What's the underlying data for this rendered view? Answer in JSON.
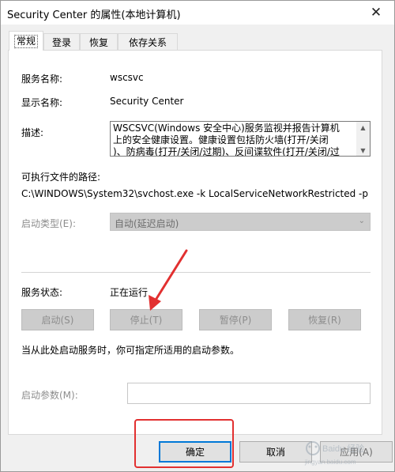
{
  "window": {
    "title": "Security Center 的属性(本地计算机)",
    "close_glyph": "✕"
  },
  "tabs": [
    {
      "label": "常规",
      "active": true
    },
    {
      "label": "登录",
      "active": false
    },
    {
      "label": "恢复",
      "active": false
    },
    {
      "label": "依存关系",
      "active": false
    }
  ],
  "general": {
    "service_name_label": "服务名称:",
    "service_name_value": "wscsvc",
    "display_name_label": "显示名称:",
    "display_name_value": "Security Center",
    "description_label": "描述:",
    "description_value": "WSCSVC(Windows 安全中心)服务监视并报告计算机\n上的安全健康设置。健康设置包括防火墙(打开/关闭\n)、防病毒(打开/关闭/过期)、反间谍软件(打开/关闭/过",
    "exe_path_label": "可执行文件的路径:",
    "exe_path_value": "C:\\WINDOWS\\System32\\svchost.exe -k LocalServiceNetworkRestricted -p",
    "startup_type_label": "启动类型(E):",
    "startup_type_value": "自动(延迟启动)",
    "service_status_label": "服务状态:",
    "service_status_value": "正在运行",
    "start_button": "启动(S)",
    "stop_button": "停止(T)",
    "pause_button": "暂停(P)",
    "resume_button": "恢复(R)",
    "start_params_hint": "当从此处启动服务时，你可指定所适用的启动参数。",
    "start_params_label": "启动参数(M):",
    "start_params_value": ""
  },
  "footer": {
    "ok_button": "确定",
    "cancel_button": "取消",
    "apply_button": "应用(A)"
  },
  "annotation": {
    "color": "#e23030"
  },
  "watermark": {
    "text": "Baidu 经验",
    "subtext": "jingyan.baidu.com"
  }
}
